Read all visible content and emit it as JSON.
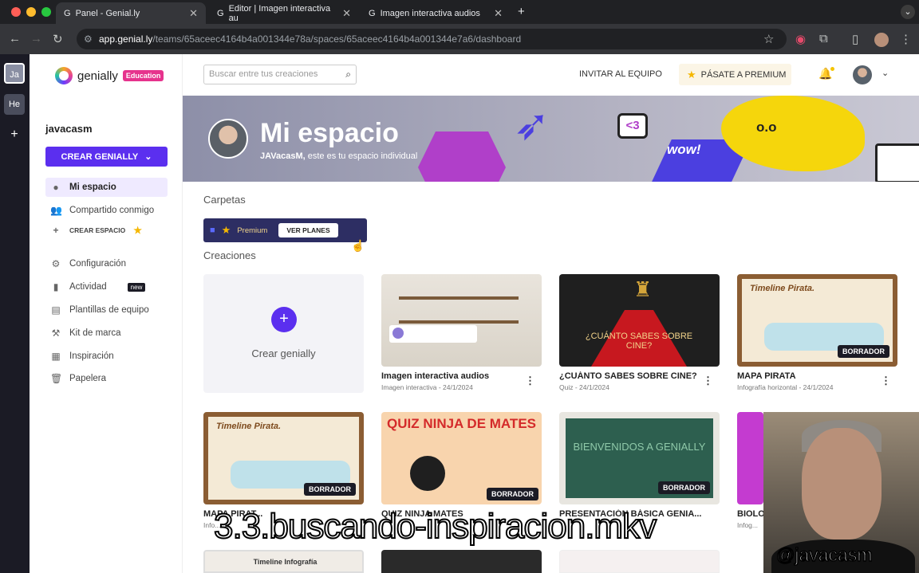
{
  "browser": {
    "tabs": [
      {
        "label": "Panel - Genial.ly",
        "active": true
      },
      {
        "label": "Editor | Imagen interactiva au",
        "active": false
      },
      {
        "label": "Imagen interactiva audios",
        "active": false
      }
    ],
    "url_host": "app.genial.ly",
    "url_path": "/teams/65aceec4164b4a001344e78a/spaces/65aceec4164b4a001344e7a6/dashboard"
  },
  "rail": {
    "items": [
      "Ja",
      "He"
    ]
  },
  "logo": {
    "word": "genially",
    "badge": "Education"
  },
  "sidebar": {
    "username": "javacasm",
    "create_label": "CREAR GENIALLY",
    "items": [
      {
        "label": "Mi espacio",
        "icon": "user-icon"
      },
      {
        "label": "Compartido conmigo",
        "icon": "users-icon"
      },
      {
        "label": "CREAR ESPACIO",
        "icon": "plus-icon"
      },
      {
        "label": "Configuración",
        "icon": "gear-icon"
      },
      {
        "label": "Actividad",
        "icon": "bar-chart-icon",
        "badge": "new"
      },
      {
        "label": "Plantillas de equipo",
        "icon": "template-icon"
      },
      {
        "label": "Kit de marca",
        "icon": "brand-kit-icon"
      },
      {
        "label": "Inspiración",
        "icon": "inspiration-icon"
      },
      {
        "label": "Papelera",
        "icon": "trash-icon"
      }
    ]
  },
  "topbar": {
    "search_placeholder": "Buscar entre tus creaciones",
    "invite": "INVITAR AL EQUIPO",
    "premium": "PÁSATE A PREMIUM"
  },
  "banner": {
    "title": "Mi espacio",
    "subtitle_user": "JAVacasM,",
    "subtitle_rest": " este es tu espacio individual",
    "deco_heart": "<3",
    "deco_wow": "wow!",
    "deco_face": "o.o"
  },
  "folders": {
    "heading": "Carpetas",
    "premium_label": "Premium",
    "plans_button": "VER PLANES"
  },
  "creations": {
    "heading": "Creaciones",
    "new_label": "Crear genially",
    "draft_badge": "BORRADOR",
    "cards": [
      {
        "title": "Imagen interactiva audios",
        "meta": "Imagen interactiva - 24/1/2024",
        "draft": false
      },
      {
        "title": "¿CUÁNTO SABES SOBRE CINE?",
        "meta": "Quiz - 24/1/2024",
        "draft": false,
        "thumb_text": "¿CUÁNTO SABES SOBRE CINE?"
      },
      {
        "title": "MAPA PIRATA",
        "meta": "Infografía horizontal - 24/1/2024",
        "draft": true,
        "thumb_text": "Timeline Pirata."
      },
      {
        "title": "MAPA PIRAT...",
        "meta": "Info...",
        "draft": true,
        "thumb_text": "Timeline Pirata."
      },
      {
        "title": "QUIZ NINJA MATES",
        "meta": "",
        "draft": true,
        "thumb_text": "QUIZ NINJA DE MATES"
      },
      {
        "title": "PRESENTACIÓN BÁSICA GENIA...",
        "meta": "",
        "draft": true,
        "thumb_text": "BIENVENIDOS A GENIALLY"
      },
      {
        "title": "BIOLO...",
        "meta": "Infog...",
        "draft": false
      }
    ],
    "row3_text": "Timeline Infografía"
  },
  "video_overlay": {
    "filename": "3.3.buscando-inspiracion.mkv",
    "handle": "@javacasm"
  }
}
